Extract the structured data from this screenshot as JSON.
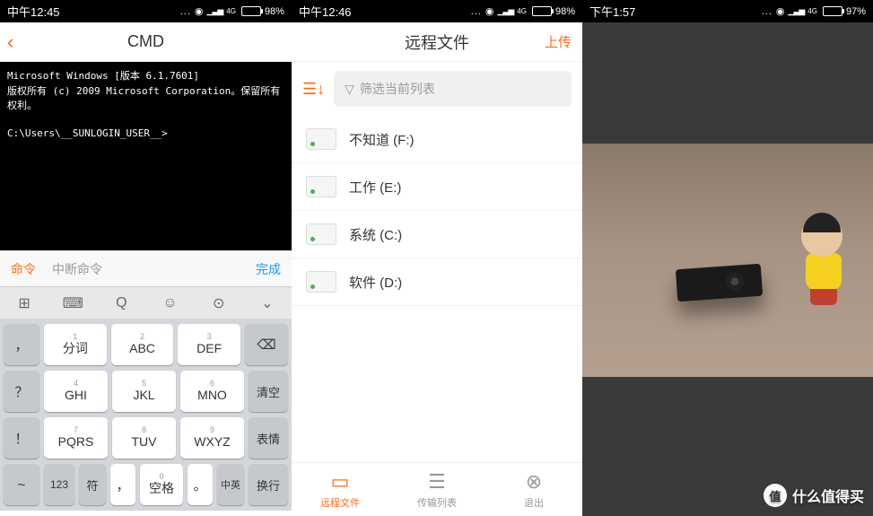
{
  "panel1": {
    "status": {
      "time": "中午12:45",
      "battery": "98%",
      "network": "4G"
    },
    "title": "CMD",
    "terminal": {
      "line1": "Microsoft Windows [版本 6.1.7601]",
      "line2": "版权所有 (c) 2009 Microsoft Corporation。保留所有权利。",
      "prompt": "C:\\Users\\__SUNLOGIN_USER__>"
    },
    "cmdbar": {
      "cmd": "命令",
      "interrupt": "中断命令",
      "done": "完成"
    },
    "keys": {
      "r1": [
        {
          "side": "，"
        },
        {
          "n": "1",
          "l": "分词"
        },
        {
          "n": "2",
          "l": "ABC"
        },
        {
          "n": "3",
          "l": "DEF"
        },
        {
          "back": "⌫"
        }
      ],
      "r2": [
        {
          "side": "？"
        },
        {
          "n": "4",
          "l": "GHI"
        },
        {
          "n": "5",
          "l": "JKL"
        },
        {
          "n": "6",
          "l": "MNO"
        },
        {
          "side2": "清空"
        }
      ],
      "r3": [
        {
          "side": "！"
        },
        {
          "n": "7",
          "l": "PQRS"
        },
        {
          "n": "8",
          "l": "TUV"
        },
        {
          "n": "9",
          "l": "WXYZ"
        },
        {
          "side2": "表情"
        }
      ],
      "r4": [
        {
          "side": "~"
        },
        {
          "s": "123"
        },
        {
          "s": "符"
        },
        {
          "s": "，"
        },
        {
          "n": "0",
          "l": "空格"
        },
        {
          "s": "。"
        },
        {
          "s": "中英"
        },
        {
          "side2": "换行"
        }
      ]
    }
  },
  "panel2": {
    "status": {
      "time": "中午12:46",
      "battery": "98%",
      "network": "4G"
    },
    "title": "远程文件",
    "upload": "上传",
    "search_placeholder": "筛选当前列表",
    "drives": [
      {
        "label": "不知道 (F:)"
      },
      {
        "label": "工作 (E:)"
      },
      {
        "label": "系统 (C:)"
      },
      {
        "label": "软件 (D:)"
      }
    ],
    "nav": [
      {
        "label": "远程文件",
        "icon": "folder"
      },
      {
        "label": "传输列表",
        "icon": "list"
      },
      {
        "label": "退出",
        "icon": "close"
      }
    ]
  },
  "panel3": {
    "status": {
      "time": "下午1:57",
      "battery": "97%",
      "network": "4G"
    },
    "watermark": {
      "badge": "值",
      "text": "什么值得买"
    }
  }
}
